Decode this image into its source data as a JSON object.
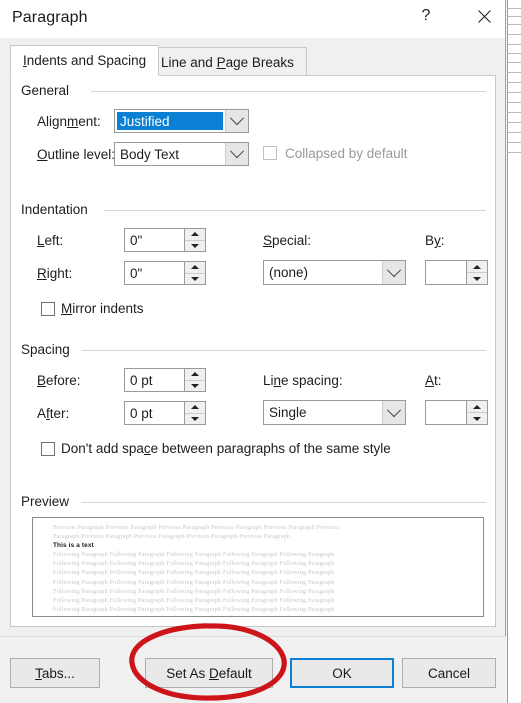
{
  "window": {
    "title": "Paragraph",
    "help_icon": "question-mark-icon",
    "close_icon": "close-icon"
  },
  "tabs": [
    {
      "label": "Indents and Spacing",
      "active": true
    },
    {
      "label": "Line and Page Breaks",
      "active": false
    }
  ],
  "general": {
    "group_label": "General",
    "alignment_label": "Alignment:",
    "alignment_value": "Justified",
    "outline_label": "Outline level:",
    "outline_value": "Body Text",
    "collapsed_label": "Collapsed by default",
    "collapsed_checked": false,
    "collapsed_disabled": true
  },
  "indentation": {
    "group_label": "Indentation",
    "left_label": "Left:",
    "left_value": "0\"",
    "right_label": "Right:",
    "right_value": "0\"",
    "special_label": "Special:",
    "special_value": "(none)",
    "by_label": "By:",
    "by_value": "",
    "mirror_label": "Mirror indents",
    "mirror_checked": false
  },
  "spacing": {
    "group_label": "Spacing",
    "before_label": "Before:",
    "before_value": "0 pt",
    "after_label": "After:",
    "after_value": "0 pt",
    "line_spacing_label": "Line spacing:",
    "line_spacing_value": "Single",
    "at_label": "At:",
    "at_value": "",
    "dont_add_label": "Don't add space between paragraphs of the same style",
    "dont_add_checked": false
  },
  "preview": {
    "group_label": "Preview",
    "previous_line_1": "Previous Paragraph Previous Paragraph Previous Paragraph Previous Paragraph Previous Paragraph Previous",
    "previous_line_2": "Paragraph Previous Paragraph Previous Paragraph Previous Paragraph Previous Paragraph",
    "sample_text": "This is a text",
    "following_line": "Following Paragraph Following Paragraph Following Paragraph Following Paragraph Following Paragraph",
    "following_count": 8
  },
  "footer": {
    "tabs_button": "Tabs...",
    "set_as_default_button": "Set As Default",
    "ok_button": "OK",
    "cancel_button": "Cancel"
  },
  "annotation": {
    "shape": "hand-drawn-ellipse",
    "color": "#CC1419",
    "target": "set-as-default-button"
  },
  "colors": {
    "accent_blue": "#0B7FD4",
    "dialog_bg": "#F0F0F0",
    "panel_bg": "#FFFFFF",
    "annotation_red": "#CC1419"
  }
}
